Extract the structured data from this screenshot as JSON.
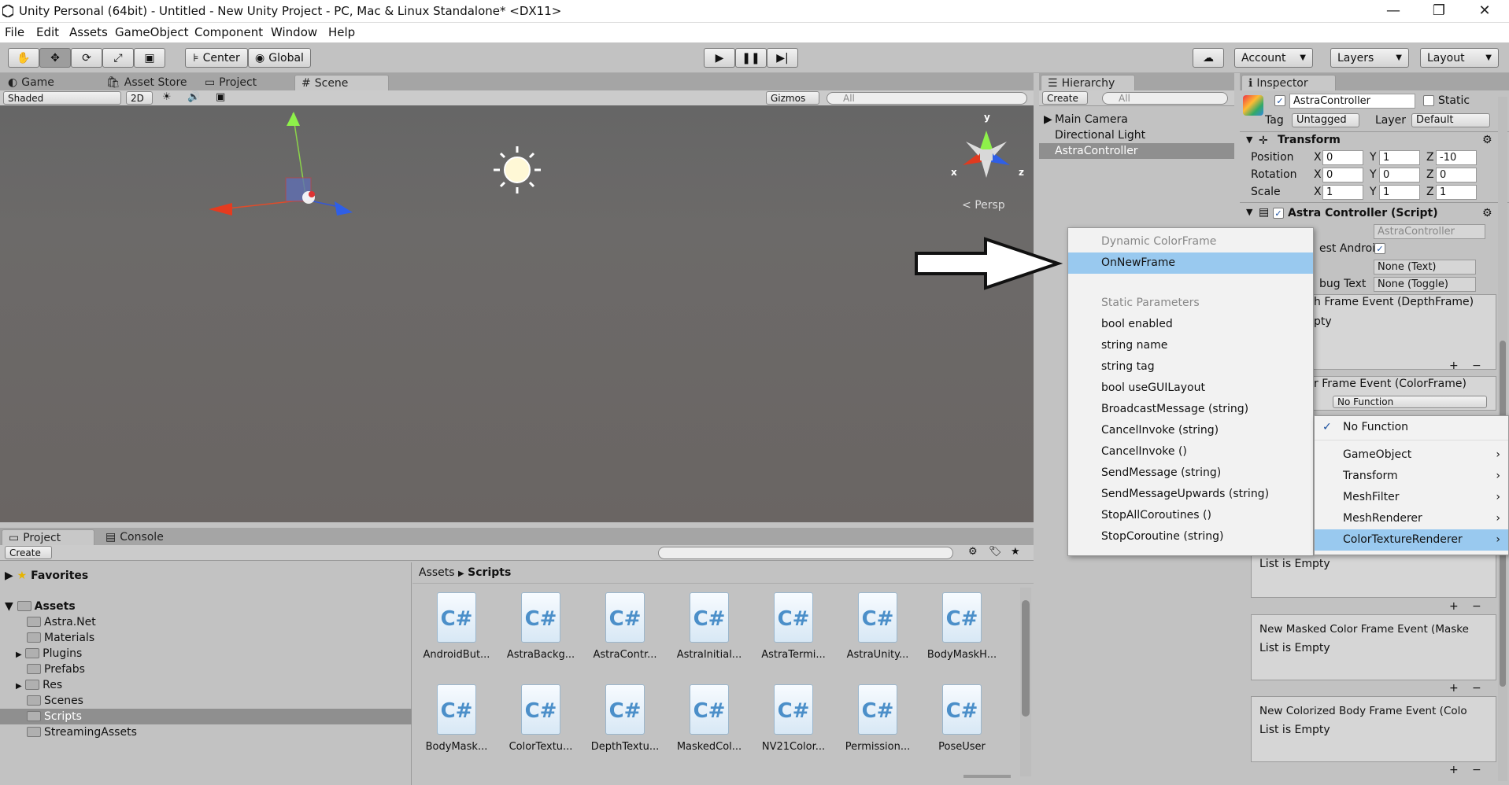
{
  "window": {
    "title": "Unity Personal (64bit) - Untitled - New Unity Project - PC, Mac & Linux Standalone* <DX11>",
    "minimize": "—",
    "restore": "❐",
    "close": "✕"
  },
  "menu": [
    "File",
    "Edit",
    "Assets",
    "GameObject",
    "Component",
    "Window",
    "Help"
  ],
  "toolbar": {
    "center": "Center",
    "global": "Global",
    "account": "Account",
    "layers": "Layers",
    "layout": "Layout"
  },
  "scene_tabs": {
    "game": "Game",
    "asset_store": "Asset Store",
    "project": "Project",
    "scene": "Scene"
  },
  "scene_bar": {
    "shaded": "Shaded",
    "mode2d": "2D",
    "gizmos": "Gizmos",
    "search_placeholder": "All"
  },
  "scene_view": {
    "persp": "Persp",
    "axis_x": "x",
    "axis_y": "y",
    "axis_z": "z"
  },
  "hierarchy": {
    "tab": "Hierarchy",
    "create": "Create",
    "search_placeholder": "All",
    "items": [
      "Main Camera",
      "Directional Light",
      "AstraController"
    ],
    "selected": "AstraController"
  },
  "inspector": {
    "tab": "Inspector",
    "object_name": "AstraController",
    "static_label": "Static",
    "tag_label": "Tag",
    "tag_value": "Untagged",
    "layer_label": "Layer",
    "layer_value": "Default",
    "transform": {
      "title": "Transform",
      "position": {
        "label": "Position",
        "x": "0",
        "y": "1",
        "z": "-10"
      },
      "rotation": {
        "label": "Rotation",
        "x": "0",
        "y": "0",
        "z": "0"
      },
      "scale": {
        "label": "Scale",
        "x": "1",
        "y": "1",
        "z": "1"
      }
    },
    "script": {
      "title": "Astra Controller (Script)",
      "script_field": "AstraController",
      "android_label": "est Androi",
      "text_field": "None (Text)",
      "debug_label": "bug Text",
      "toggle_field": "None (Toggle)",
      "depth_event": "h Frame Event (DepthFrame)",
      "depth_empty": "pty",
      "color_event": "r Frame Event (ColorFrame)",
      "color_function": "No Function"
    },
    "events": [
      {
        "title": "",
        "empty": "List is Empty"
      },
      {
        "title": "New Masked Color Frame Event (Maske",
        "empty": "List is Empty"
      },
      {
        "title": "New Colorized Body Frame Event (Colo",
        "empty": "List is Empty"
      }
    ],
    "plus": "+",
    "minus": "−"
  },
  "context_menu": {
    "items": [
      "Dynamic ColorFrame",
      "OnNewFrame",
      "Static Parameters",
      "bool enabled",
      "string name",
      "string tag",
      "bool useGUILayout",
      "BroadcastMessage (string)",
      "CancelInvoke (string)",
      "CancelInvoke ()",
      "SendMessage (string)",
      "SendMessageUpwards (string)",
      "StopAllCoroutines ()",
      "StopCoroutine (string)"
    ],
    "selected": "OnNewFrame"
  },
  "function_menu": {
    "items": [
      "No Function",
      "GameObject",
      "Transform",
      "MeshFilter",
      "MeshRenderer",
      "ColorTextureRenderer"
    ],
    "checked": "No Function",
    "selected": "ColorTextureRenderer"
  },
  "project": {
    "tab": "Project",
    "console_tab": "Console",
    "create": "Create",
    "favorites": "Favorites",
    "assets": "Assets",
    "folders": [
      "Astra.Net",
      "Materials",
      "Plugins",
      "Prefabs",
      "Res",
      "Scenes",
      "Scripts",
      "StreamingAssets"
    ],
    "selected_folder": "Scripts",
    "breadcrumb": [
      "Assets",
      "Scripts"
    ],
    "files": [
      "AndroidBut...",
      "AstraBackg...",
      "AstraContr...",
      "AstraInitial...",
      "AstraTermi...",
      "AstraUnity...",
      "BodyMaskH...",
      "BodyMask...",
      "ColorTextu...",
      "DepthTextu...",
      "MaskedCol...",
      "NV21Color...",
      "Permission...",
      "PoseUser"
    ]
  },
  "colors": {
    "selection": "#99c9ef",
    "panel": "#c2c2c2",
    "scene": "#6a6766",
    "hier_selected": "#8f8f8f"
  }
}
